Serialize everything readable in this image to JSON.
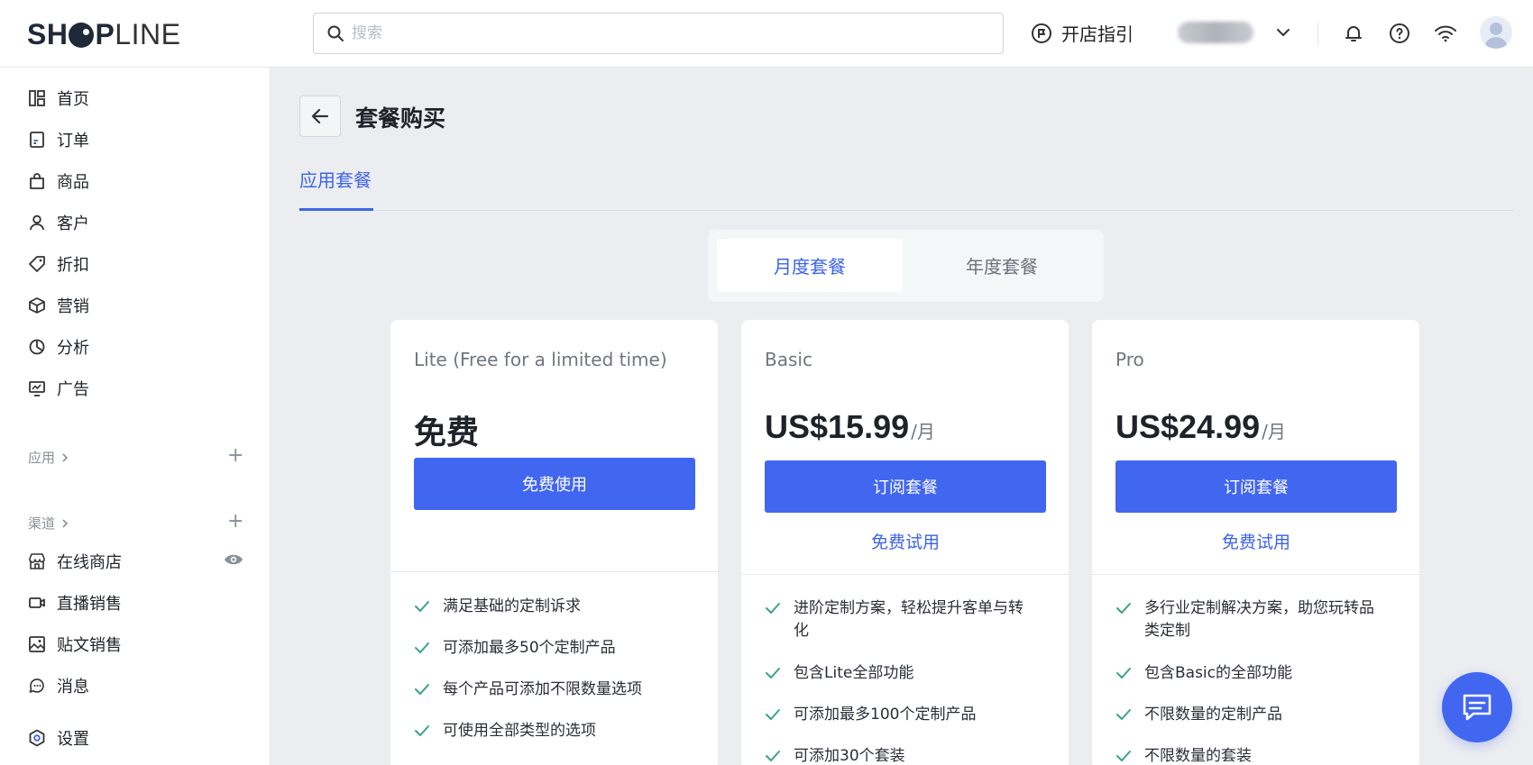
{
  "header": {
    "logo": {
      "part1": "SH",
      "part2": "P",
      "part3": "LINE"
    },
    "search_placeholder": "搜索",
    "guide_label": "开店指引"
  },
  "sidebar": {
    "items": [
      {
        "label": "首页",
        "icon": "dashboard-icon"
      },
      {
        "label": "订单",
        "icon": "order-icon"
      },
      {
        "label": "商品",
        "icon": "bag-icon"
      },
      {
        "label": "客户",
        "icon": "user-icon"
      },
      {
        "label": "折扣",
        "icon": "tag-icon"
      },
      {
        "label": "营销",
        "icon": "box-icon"
      },
      {
        "label": "分析",
        "icon": "pie-chart-icon"
      },
      {
        "label": "广告",
        "icon": "ad-icon"
      }
    ],
    "apps_label": "应用",
    "channels_label": "渠道",
    "channels": [
      {
        "label": "在线商店",
        "icon": "store-icon"
      },
      {
        "label": "直播销售",
        "icon": "video-icon"
      },
      {
        "label": "贴文销售",
        "icon": "image-icon"
      },
      {
        "label": "消息",
        "icon": "chat-icon"
      }
    ],
    "settings_label": "设置"
  },
  "main": {
    "title": "套餐购买",
    "tab_label": "应用套餐",
    "toggle": {
      "monthly": "月度套餐",
      "yearly": "年度套餐"
    },
    "plans": [
      {
        "name": "Lite (Free for a limited time)",
        "price": "免费",
        "unit": "",
        "cta": "免费使用",
        "trial": "",
        "features": [
          "满足基础的定制诉求",
          "可添加最多50个定制产品",
          "每个产品可添加不限数量选项",
          "可使用全部类型的选项"
        ]
      },
      {
        "name": "Basic",
        "price": "US$15.99",
        "unit": "/月",
        "cta": "订阅套餐",
        "trial": "免费试用",
        "features": [
          "进阶定制方案，轻松提升客单与转化",
          "包含Lite全部功能",
          "可添加最多100个定制产品",
          "可添加30个套装"
        ]
      },
      {
        "name": "Pro",
        "price": "US$24.99",
        "unit": "/月",
        "cta": "订阅套餐",
        "trial": "免费试用",
        "features": [
          "多行业定制解决方案，助您玩转品类定制",
          "包含Basic的全部功能",
          "不限数量的定制产品",
          "不限数量的套装"
        ]
      }
    ]
  },
  "colors": {
    "accent": "#4166f0",
    "link": "#3d63e8",
    "check": "#3aa37f"
  }
}
